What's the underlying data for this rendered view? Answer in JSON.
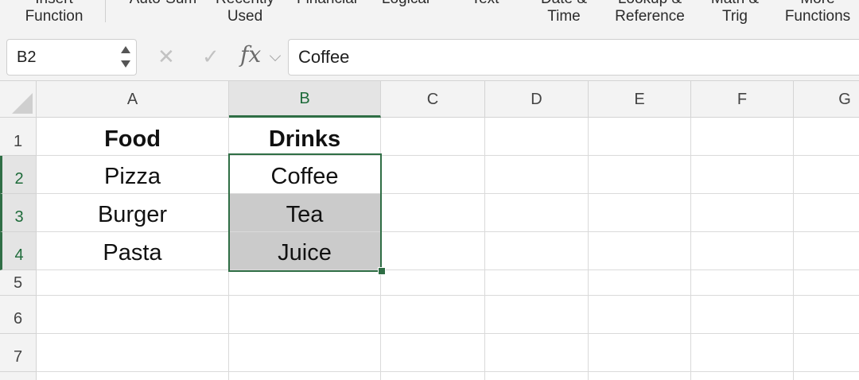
{
  "ribbon": {
    "items": [
      {
        "line1": "Insert",
        "line2": "Function"
      },
      {
        "line1": "Auto-Sum",
        "line2": ""
      },
      {
        "line1": "Recently",
        "line2": "Used"
      },
      {
        "line1": "Financial",
        "line2": ""
      },
      {
        "line1": "Logical",
        "line2": ""
      },
      {
        "line1": "Text",
        "line2": ""
      },
      {
        "line1": "Date &",
        "line2": "Time"
      },
      {
        "line1": "Lookup &",
        "line2": "Reference"
      },
      {
        "line1": "Math &",
        "line2": "Trig"
      },
      {
        "line1": "More",
        "line2": "Functions"
      }
    ]
  },
  "formula_bar": {
    "name_box": "B2",
    "cancel_icon": "close-icon",
    "enter_icon": "checkmark-icon",
    "fx_label": "fx",
    "value": "Coffee"
  },
  "grid": {
    "columns": [
      "A",
      "B",
      "C",
      "D",
      "E",
      "F",
      "G"
    ],
    "selected_column": "B",
    "rows": [
      "1",
      "2",
      "3",
      "4",
      "5",
      "6",
      "7"
    ],
    "selected_rows": [
      "2",
      "3",
      "4"
    ],
    "cells": {
      "A1": "Food",
      "B1": "Drinks",
      "A2": "Pizza",
      "B2": "Coffee",
      "A3": "Burger",
      "B3": "Tea",
      "A4": "Pasta",
      "B4": "Juice"
    },
    "selection_range": "B2:B4",
    "selection_color": "#2f6e45",
    "highlight_color": "#cbcbcb"
  }
}
